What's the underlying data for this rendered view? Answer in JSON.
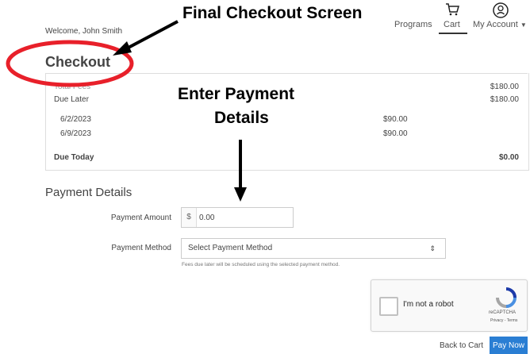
{
  "header": {
    "welcome": "Welcome, John Smith",
    "nav": {
      "programs": "Programs",
      "cart": "Cart",
      "account": "My Account"
    }
  },
  "checkout": {
    "title": "Checkout",
    "rows": {
      "total_label": "Total Fees",
      "total_amount": "$180.00",
      "due_later_label": "Due Later",
      "due_later_amount": "$180.00",
      "installments": [
        {
          "date": "6/2/2023",
          "amount": "$90.00"
        },
        {
          "date": "6/9/2023",
          "amount": "$90.00"
        }
      ],
      "due_today_label": "Due Today",
      "due_today_amount": "$0.00"
    }
  },
  "payment": {
    "section_title": "Payment Details",
    "amount_label": "Payment Amount",
    "currency_symbol": "$",
    "amount_value": "0.00",
    "method_label": "Payment Method",
    "method_selected": "Select Payment Method",
    "method_help": "Fees due later will be scheduled using the selected payment method."
  },
  "recaptcha": {
    "label": "I'm not a robot",
    "brand": "reCAPTCHA",
    "terms": "Privacy - Terms"
  },
  "actions": {
    "back_to_cart": "Back to Cart",
    "pay_now": "Pay Now"
  },
  "annotations": {
    "top": "Final Checkout Screen",
    "mid_line1": "Enter Payment",
    "mid_line2": "Details"
  },
  "colors": {
    "primary": "#2a7ed3",
    "annotation_circle": "#e8202a"
  }
}
